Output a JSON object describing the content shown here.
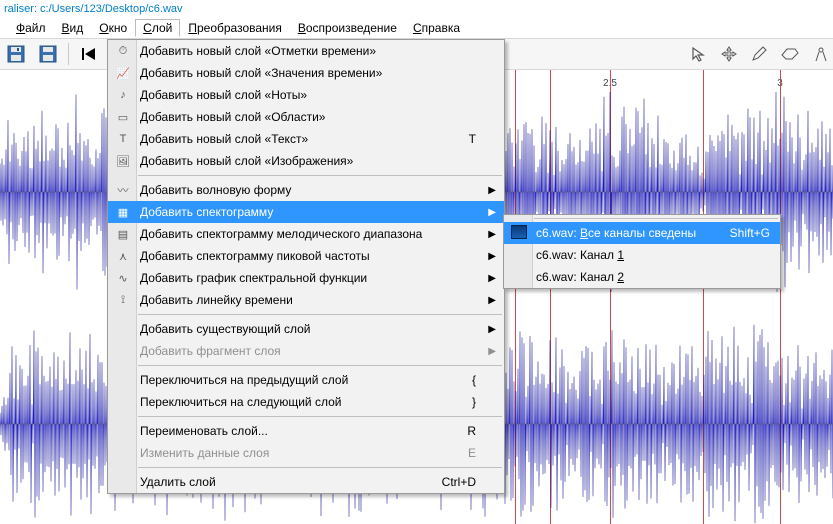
{
  "title": "raliser: c:/Users/123/Desktop/c6.wav",
  "menus": [
    "Файл",
    "Вид",
    "Окно",
    "Слой",
    "Преобразования",
    "Воспроизведение",
    "Справка"
  ],
  "menus_ul": [
    "Ф",
    "В",
    "О",
    "С",
    "П",
    "В",
    "С"
  ],
  "open_index": 3,
  "ruler": {
    "labels": [
      "2.5",
      "3"
    ]
  },
  "layer_menu": {
    "g1": [
      "Добавить новый слой «Отметки времени»",
      "Добавить новый слой «Значения времени»",
      "Добавить новый слой «Ноты»",
      "Добавить новый слой «Области»",
      "Добавить новый слой «Текст»",
      "Добавить новый слой «Изображения»"
    ],
    "g1_sc": [
      "",
      "",
      "",
      "",
      "T",
      ""
    ],
    "g2": [
      "Добавить волновую форму",
      "Добавить спектограмму",
      "Добавить спектограмму мелодического диапазона",
      "Добавить спектограмму пиковой частоты",
      "Добавить график спектральной функции",
      "Добавить линейку времени"
    ],
    "g2_hi": 1,
    "g3": [
      "Добавить существующий слой",
      "Добавить фрагмент слоя"
    ],
    "g3_dis": [
      false,
      true
    ],
    "g4": [
      "Переключиться на предыдущий слой",
      "Переключиться на следующий слой"
    ],
    "g4_sc": [
      "{",
      "}"
    ],
    "g5": [
      "Переименовать слой...",
      "Изменить данные слоя"
    ],
    "g5_sc": [
      "R",
      "E"
    ],
    "g5_dis": [
      false,
      true
    ],
    "g6": [
      "Удалить слой"
    ],
    "g6_sc": [
      "Ctrl+D"
    ]
  },
  "submenu": {
    "items": [
      "c6.wav: Все каналы сведены",
      "c6.wav: Канал 1",
      "c6.wav: Канал 2"
    ],
    "items_ul": [
      "В",
      "1",
      "2"
    ],
    "sc": [
      "Shift+G",
      "",
      ""
    ],
    "hi": 0
  },
  "colors": {
    "wave": "#0300d2",
    "wave_dark": "#020088",
    "playline": "#c84d4d"
  }
}
